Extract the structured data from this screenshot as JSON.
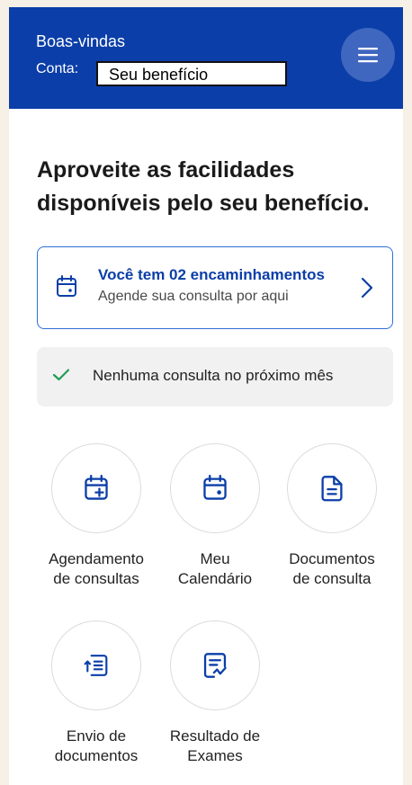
{
  "header": {
    "greeting": "Boas-vindas",
    "account_label": "Conta:",
    "account_value": "Seu benefício",
    "menu_icon": "hamburger-menu-icon"
  },
  "main": {
    "headline_line1": "Aproveite as facilidades",
    "headline_line2": "disponíveis pelo seu benefício.",
    "referral": {
      "title": "Você tem 02 encaminhamentos",
      "subtitle": "Agende sua consulta por aqui",
      "icon": "calendar-icon"
    },
    "status": {
      "text": "Nenhuma consulta no próximo mês",
      "icon": "check-icon"
    },
    "shortcuts": [
      {
        "line1": "Agendamento",
        "line2": "de consultas",
        "icon": "calendar-add-icon"
      },
      {
        "line1": "Meu",
        "line2": "Calendário",
        "icon": "calendar-icon"
      },
      {
        "line1": "Documentos",
        "line2": "de consulta",
        "icon": "document-icon"
      },
      {
        "line1": "Envio de",
        "line2": "documentos",
        "icon": "document-upload-icon"
      },
      {
        "line1": "Resultado de",
        "line2": "Exames",
        "icon": "exam-result-icon"
      }
    ]
  },
  "colors": {
    "primary": "#0b3ea8",
    "menu_button": "#3f67c0",
    "accent_border": "#2f6fd8",
    "check_green": "#1f9d55"
  }
}
